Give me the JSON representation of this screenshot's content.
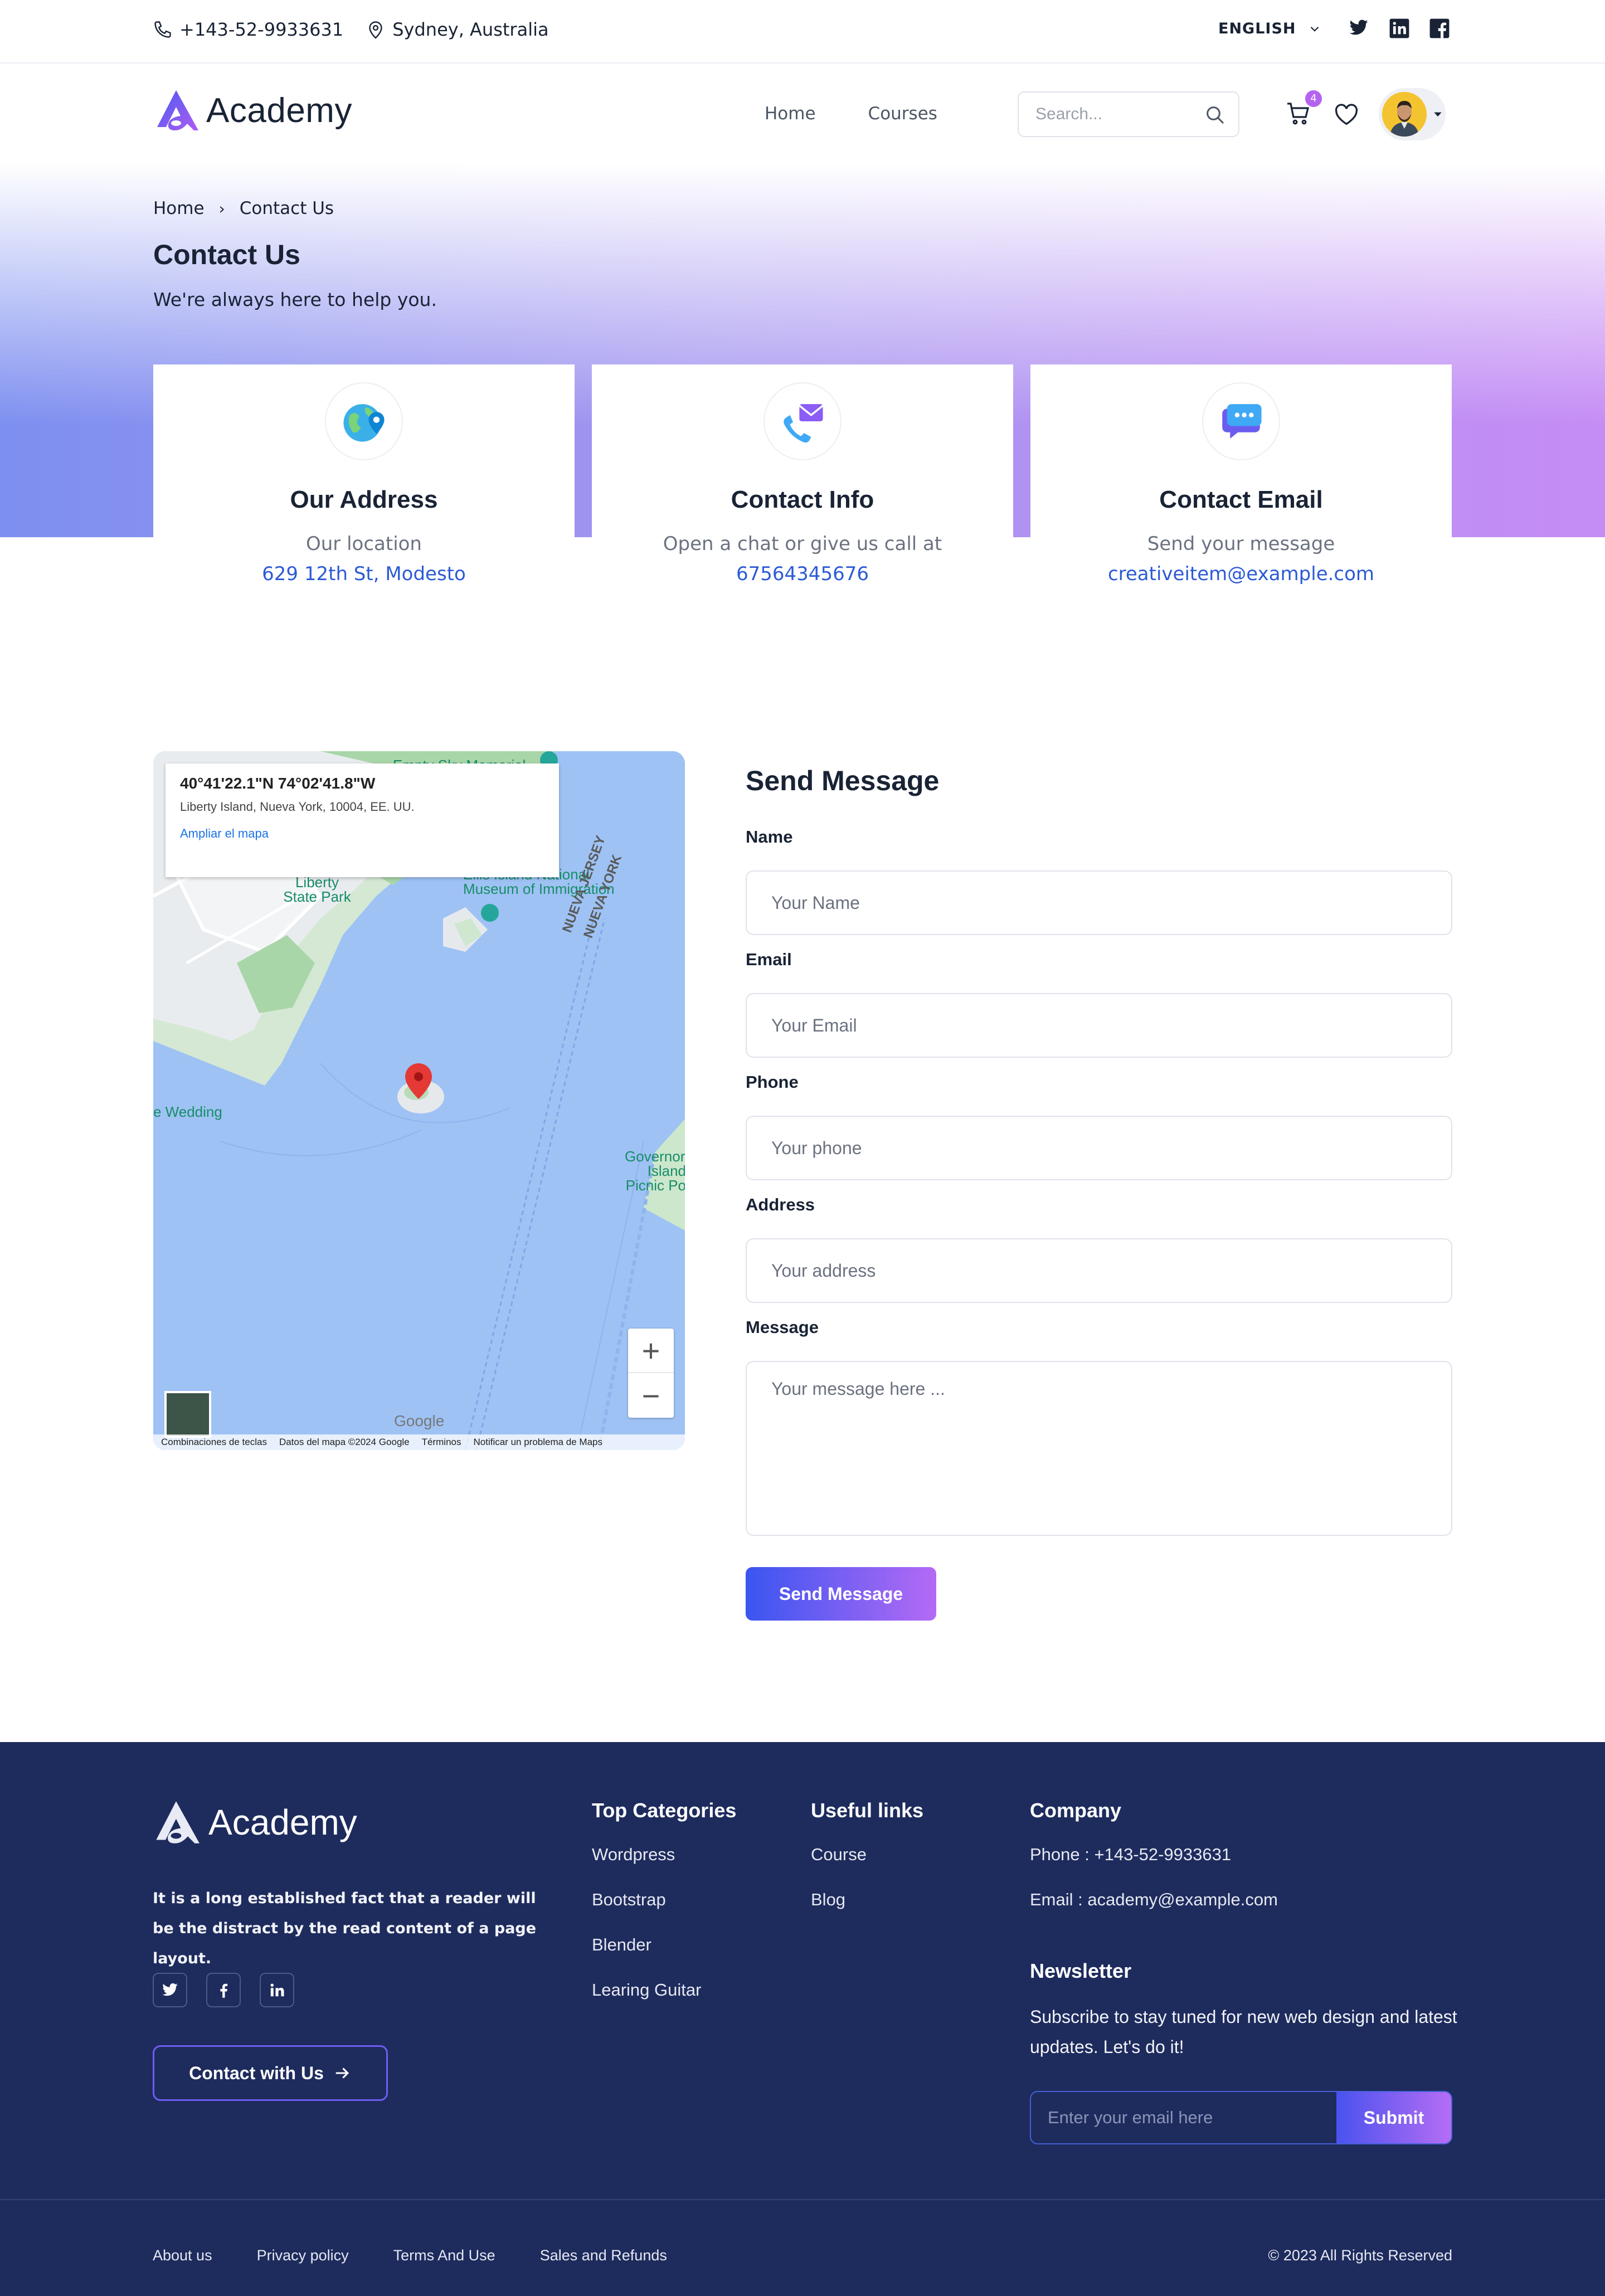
{
  "topbar": {
    "phone": "+143-52-9933631",
    "location": "Sydney, Australia",
    "language": "ENGLISH",
    "social_icons": [
      "twitter-icon",
      "linkedin-icon",
      "facebook-icon"
    ]
  },
  "header": {
    "logo_text": "Academy",
    "nav": [
      "Home",
      "Courses"
    ],
    "search_placeholder": "Search...",
    "cart_count": "4"
  },
  "hero": {
    "breadcrumb": [
      "Home",
      "Contact Us"
    ],
    "title": "Contact Us",
    "subtitle": "We're always here to help you."
  },
  "cards": [
    {
      "title": "Our Address",
      "line1": "Our location",
      "line2": "629 12th St, Modesto",
      "icon": "globe-icon"
    },
    {
      "title": "Contact Info",
      "line1": "Open a chat or give us call at",
      "line2": "67564345676",
      "icon": "phone-mail-icon"
    },
    {
      "title": "Contact Email",
      "line1": "Send your message",
      "line2": "creativeitem@example.com",
      "icon": "chat-bubble-icon"
    }
  ],
  "map": {
    "coord": "40°41'22.1\"N 74°02'41.8\"W",
    "address": "Liberty Island, Nueva York, 10004, EE. UU.",
    "enlarge_link": "Ampliar el mapa",
    "labels": {
      "empty_sky": "Empty Sky Memorial",
      "liberty_park": "Liberty State Park",
      "ellis": "Ellis Island National Museum of Immigration",
      "nueva_jersey": "NUEVA JERSEY",
      "nueva_york": "NUEVA YORK",
      "wedding": "e Wedding",
      "governors": "Governors Island Picnic Po"
    },
    "attribution": [
      "Combinaciones de teclas",
      "Datos del mapa ©2024 Google",
      "Términos",
      "Notificar un problema de Maps"
    ],
    "google": "Google",
    "zoom_in": "+",
    "zoom_out": "−"
  },
  "form": {
    "title": "Send Message",
    "name_label": "Name",
    "name_placeholder": "Your Name",
    "email_label": "Email",
    "email_placeholder": "Your Email",
    "phone_label": "Phone",
    "phone_placeholder": "Your phone",
    "address_label": "Address",
    "address_placeholder": "Your address",
    "message_label": "Message",
    "message_placeholder": "Your message here ...",
    "submit": "Send Message"
  },
  "footer": {
    "logo_text": "Academy",
    "description": "It is a long established fact that a reader will be the distract by the read content of a page layout.",
    "contact_button": "Contact with Us",
    "top_categories": {
      "title": "Top Categories",
      "items": [
        "Wordpress",
        "Bootstrap",
        "Blender",
        "Learing Guitar"
      ]
    },
    "useful_links": {
      "title": "Useful links",
      "items": [
        "Course",
        "Blog"
      ]
    },
    "company": {
      "title": "Company",
      "phone": "Phone : +143-52-9933631",
      "email": "Email : academy@example.com"
    },
    "newsletter": {
      "title": "Newsletter",
      "text": "Subscribe to stay tuned for new web design and latest updates. Let's do it!",
      "placeholder": "Enter your email here",
      "button": "Submit"
    },
    "bottom_links": [
      "About us",
      "Privacy policy",
      "Terms And Use",
      "Sales and Refunds"
    ],
    "copyright": "© 2023 All Rights Reserved"
  },
  "colors": {
    "primary_text": "#192335",
    "link_blue": "#2c5ad6",
    "footer_bg": "#1e2b5d",
    "gradient_start": "#3a55f0",
    "gradient_end": "#b46af5"
  }
}
